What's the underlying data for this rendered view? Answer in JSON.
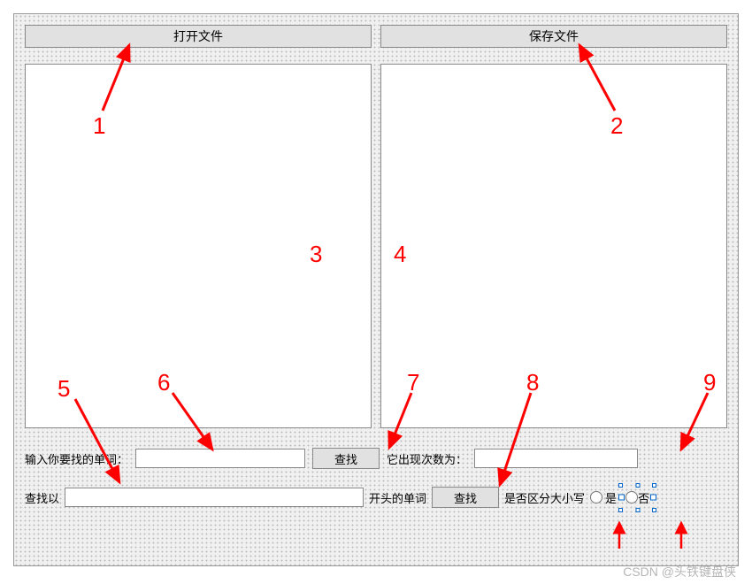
{
  "buttons": {
    "open": "打开文件",
    "save": "保存文件",
    "search1": "查找",
    "search2": "查找"
  },
  "labels": {
    "input_word": "输入你要找的单词：",
    "count_prefix": "它出现次数为：",
    "prefix_search_left": "查找以",
    "prefix_search_right": "开头的单词",
    "case_sensitive": "是否区分大小写",
    "yes": "是",
    "no": "否"
  },
  "inputs": {
    "word_value": "",
    "count_value": "",
    "prefix_value": ""
  },
  "annotations": {
    "n1": "1",
    "n2": "2",
    "n3": "3",
    "n4": "4",
    "n5": "5",
    "n6": "6",
    "n7": "7",
    "n8": "8",
    "n9": "9"
  },
  "watermark": "CSDN @头铁键盘侠",
  "colors": {
    "annotation": "#ff0000"
  }
}
